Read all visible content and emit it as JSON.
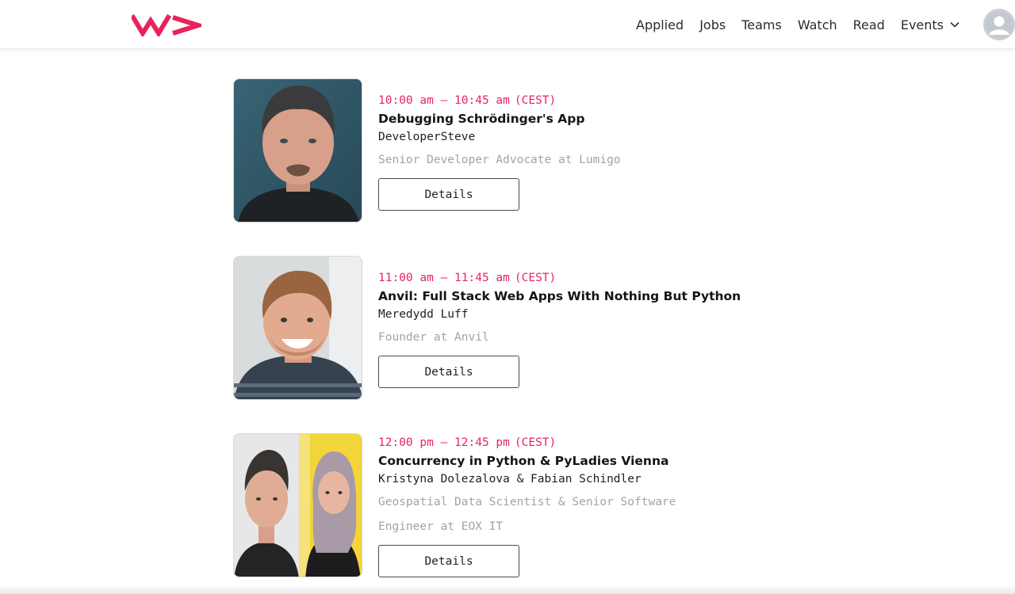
{
  "header": {
    "logo_icon": "workingdev-logo",
    "brand_color": "#e8245a",
    "nav": [
      {
        "label": "Applied"
      },
      {
        "label": "Jobs"
      },
      {
        "label": "Teams"
      },
      {
        "label": "Watch"
      },
      {
        "label": "Read"
      },
      {
        "label": "Events"
      }
    ],
    "user_icon": "user-avatar-icon"
  },
  "talks": [
    {
      "time": "10:00 am – 10:45 am",
      "timezone": "(CEST)",
      "title": "Debugging Schrödinger's App",
      "speaker": "DeveloperSteve",
      "role": "Senior Developer Advocate at Lumigo",
      "button": "Details"
    },
    {
      "time": "11:00 am – 11:45 am",
      "timezone": "(CEST)",
      "title": "Anvil: Full Stack Web Apps With Nothing But Python",
      "speaker": "Meredydd Luff",
      "role": "Founder at Anvil",
      "button": "Details"
    },
    {
      "time": "12:00 pm – 12:45 pm",
      "timezone": "(CEST)",
      "title": "Concurrency in Python & PyLadies Vienna",
      "speaker": "Kristyna Dolezalova & Fabian Schindler",
      "role": "Geospatial Data Scientist & Senior Software Engineer at EOX IT",
      "button": "Details"
    }
  ]
}
